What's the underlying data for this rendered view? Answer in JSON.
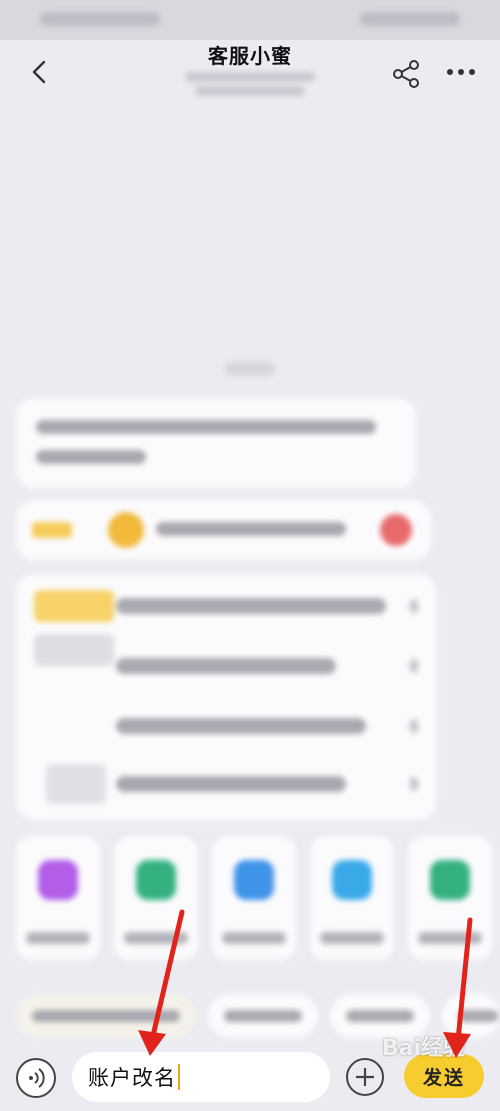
{
  "header": {
    "title": "客服小蜜",
    "back_icon": "chevron-left-icon",
    "share_icon": "share-icon",
    "more_icon": "more-dots-icon"
  },
  "input_bar": {
    "voice_icon": "voice-wave-icon",
    "input_value": "账户改名",
    "add_icon": "plus-circle-icon",
    "send_label": "发送"
  },
  "watermark": {
    "text": "Bai经验"
  },
  "colors": {
    "accent": "#f7cc2e",
    "arrow": "#e0241b",
    "background": "#ecebf2"
  }
}
